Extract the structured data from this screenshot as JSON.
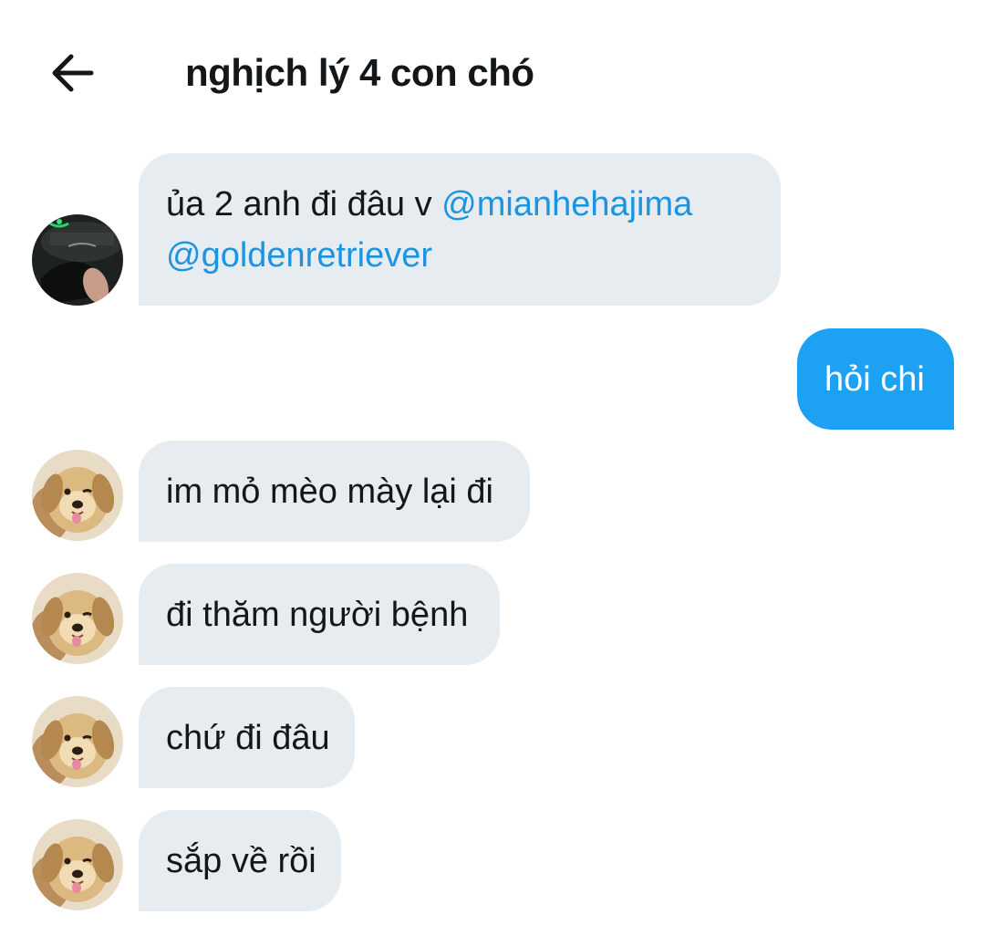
{
  "header": {
    "title": "nghịch lý 4 con chó",
    "back_icon": "arrow-left-icon"
  },
  "colors": {
    "received_bubble": "#e6ecf0",
    "sent_bubble": "#1da1f2",
    "mention": "#1b95e0",
    "text": "#14171a"
  },
  "messages": [
    {
      "direction": "received",
      "avatar": "user-avatar-dark",
      "line1_text": "ủa 2 anh đi đâu v ",
      "mention1": "@mianhehajima",
      "mention2": "@goldenretriever"
    },
    {
      "direction": "sent",
      "text": "hỏi chi"
    },
    {
      "direction": "received",
      "avatar": "golden-retriever-avatar",
      "text": "im mỏ mèo mày lại đi"
    },
    {
      "direction": "received",
      "avatar": "golden-retriever-avatar",
      "text": "đi thăm người bệnh"
    },
    {
      "direction": "received",
      "avatar": "golden-retriever-avatar",
      "text": "chứ đi đâu"
    },
    {
      "direction": "received",
      "avatar": "golden-retriever-avatar",
      "text": "sắp về rồi"
    }
  ]
}
